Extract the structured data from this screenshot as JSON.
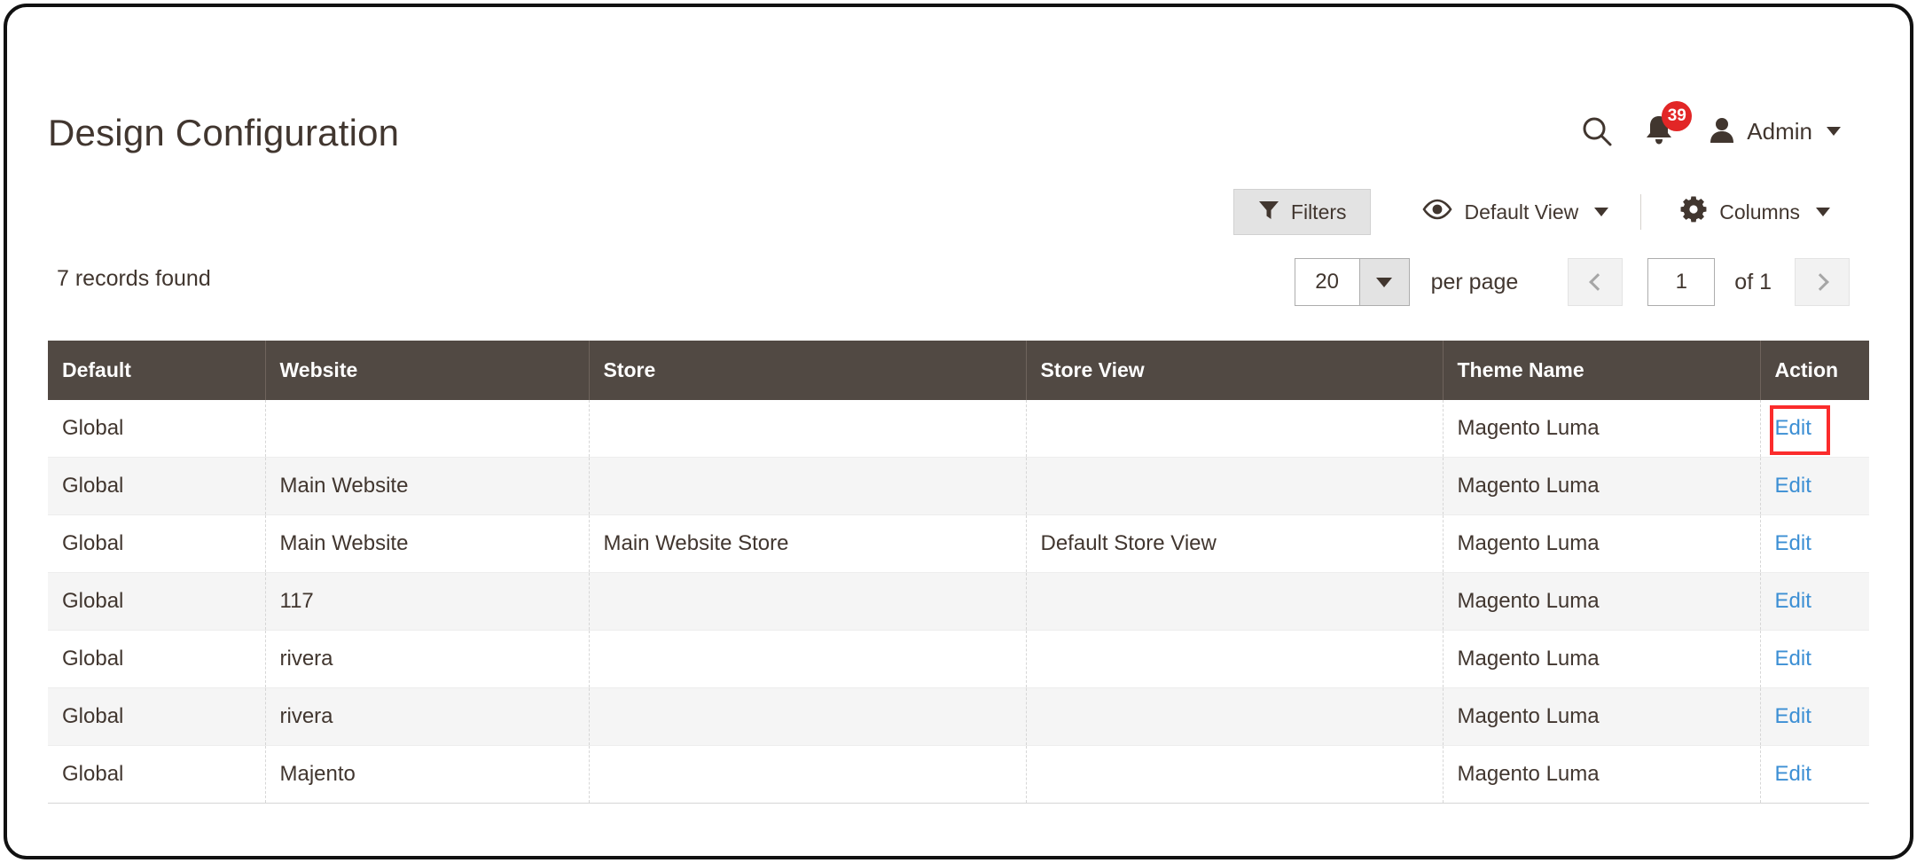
{
  "header": {
    "title": "Design Configuration",
    "search_icon": "search-icon",
    "notifications": {
      "icon": "bell-icon",
      "count": "39"
    },
    "admin": {
      "icon": "user-avatar-icon",
      "label": "Admin",
      "caret": "chevron-down-icon"
    }
  },
  "toolbar": {
    "filters_label": "Filters",
    "filters_icon": "funnel-icon",
    "view_label": "Default View",
    "view_icon": "eye-icon",
    "columns_label": "Columns",
    "columns_icon": "gear-icon"
  },
  "grid_summary": {
    "records_found": "7 records found"
  },
  "pagination": {
    "per_page_value": "20",
    "per_page_label": "per page",
    "current_page": "1",
    "total_pages": "of 1",
    "prev_icon": "chevron-left-icon",
    "next_icon": "chevron-right-icon"
  },
  "table": {
    "columns": [
      "Default",
      "Website",
      "Store",
      "Store View",
      "Theme Name",
      "Action"
    ],
    "rows": [
      {
        "default": "Global",
        "website": "",
        "store": "",
        "store_view": "",
        "theme_name": "Magento Luma",
        "action": "Edit",
        "highlighted": true
      },
      {
        "default": "Global",
        "website": "Main Website",
        "store": "",
        "store_view": "",
        "theme_name": "Magento Luma",
        "action": "Edit",
        "highlighted": false
      },
      {
        "default": "Global",
        "website": "Main Website",
        "store": "Main Website Store",
        "store_view": "Default Store View",
        "theme_name": "Magento Luma",
        "action": "Edit",
        "highlighted": false
      },
      {
        "default": "Global",
        "website": "117",
        "store": "",
        "store_view": "",
        "theme_name": "Magento Luma",
        "action": "Edit",
        "highlighted": false
      },
      {
        "default": "Global",
        "website": "rivera",
        "store": "",
        "store_view": "",
        "theme_name": "Magento Luma",
        "action": "Edit",
        "highlighted": false
      },
      {
        "default": "Global",
        "website": "rivera",
        "store": "",
        "store_view": "",
        "theme_name": "Magento Luma",
        "action": "Edit",
        "highlighted": false
      },
      {
        "default": "Global",
        "website": "Majento",
        "store": "",
        "store_view": "",
        "theme_name": "Magento Luma",
        "action": "Edit",
        "highlighted": false
      }
    ]
  },
  "colors": {
    "table_header_bg": "#514943",
    "link_blue": "#3c8fd4",
    "badge_red": "#e22626",
    "highlight_red": "#fb2c2c",
    "text_dark": "#41362f"
  }
}
